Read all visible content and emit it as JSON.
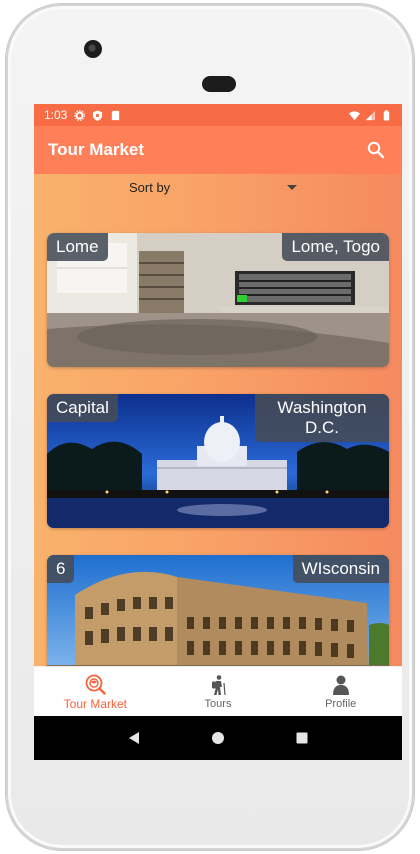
{
  "status_bar": {
    "time": "1:03"
  },
  "app_bar": {
    "title": "Tour Market"
  },
  "sort": {
    "label": "Sort by"
  },
  "tours": [
    {
      "title": "Lome",
      "location": "Lome, Togo"
    },
    {
      "title": "Capital",
      "location": "Washington D.C."
    },
    {
      "title": "6",
      "location": "WIsconsin"
    }
  ],
  "bottom_nav": [
    {
      "label": "Tour Market",
      "icon": "tour-market-icon",
      "active": true
    },
    {
      "label": "Tours",
      "icon": "hiker-icon",
      "active": false
    },
    {
      "label": "Profile",
      "icon": "profile-icon",
      "active": false
    }
  ],
  "colors": {
    "primary": "#ff7f59",
    "status_bar": "#f76b45",
    "accent": "#f4643c"
  }
}
